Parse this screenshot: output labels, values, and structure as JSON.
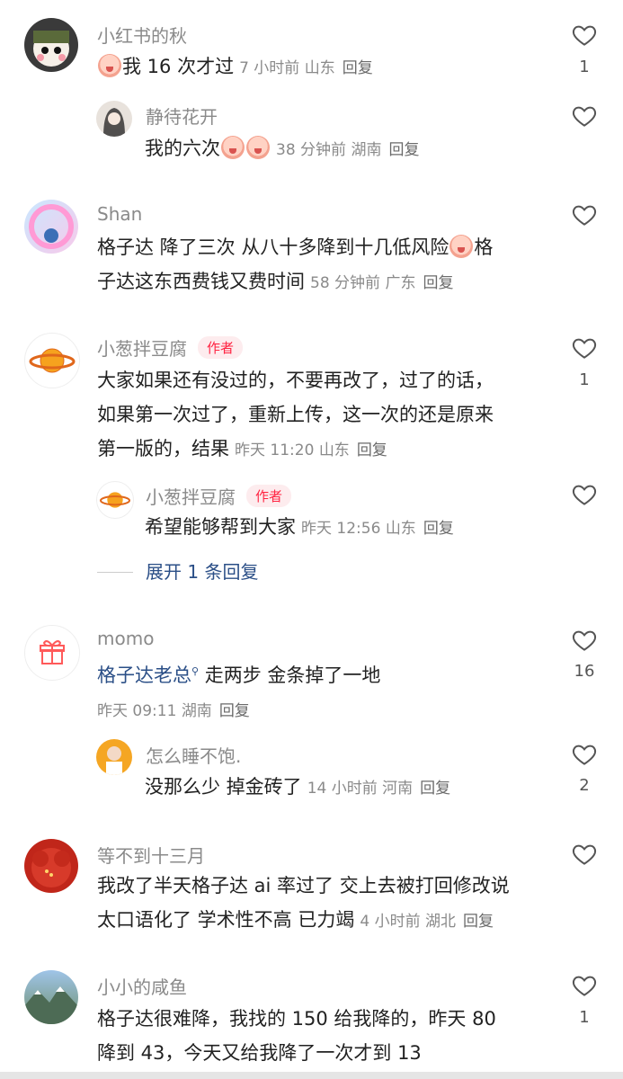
{
  "comments": [
    {
      "name": "小红书的秋",
      "text": "我 16 次才过",
      "time": "7 小时前",
      "location": "山东",
      "reply_label": "回复",
      "likes": "1",
      "replies": [
        {
          "name": "静待花开",
          "text": "我的六次",
          "time": "38 分钟前",
          "location": "湖南",
          "reply_label": "回复"
        }
      ]
    },
    {
      "name": "Shan",
      "text_line1": "格子达 降了三次 从八十多降到十几低风险",
      "text_line1_tail": "格",
      "text_line2": "子达这东西费钱又费时间",
      "time": "58 分钟前",
      "location": "广东",
      "reply_label": "回复"
    },
    {
      "name": "小葱拌豆腐",
      "badge": "作者",
      "text_line1": "大家如果还有没过的，不要再改了，过了的话，",
      "text_line2": "如果第一次过了，重新上传，这一次的还是原来",
      "text_line3": "第一版的，结果",
      "time": "昨天 11:20",
      "location": "山东",
      "reply_label": "回复",
      "likes": "1",
      "replies": [
        {
          "name": "小葱拌豆腐",
          "badge": "作者",
          "text": "希望能够帮到大家",
          "time": "昨天 12:56",
          "location": "山东",
          "reply_label": "回复"
        }
      ],
      "expand_label": "展开 1 条回复"
    },
    {
      "name": "momo",
      "mention": "格子达老总",
      "text": " 走两步 金条掉了一地",
      "time": "昨天 09:11",
      "location": "湖南",
      "reply_label": "回复",
      "likes": "16",
      "replies": [
        {
          "name": "怎么睡不饱.",
          "text": "没那么少 掉金砖了",
          "time": "14 小时前",
          "location": "河南",
          "reply_label": "回复",
          "likes": "2"
        }
      ]
    },
    {
      "name": "等不到十三月",
      "text_line1": "我改了半天格子达 ai 率过了 交上去被打回修改说",
      "text_line2": "太口语化了 学术性不高 已力竭",
      "time": "4 小时前",
      "location": "湖北",
      "reply_label": "回复"
    },
    {
      "name": "小小的咸鱼",
      "text_line1": "格子达很难降，我找的 150 给我降的，昨天 80",
      "text_line2": "降到 43，今天又给我降了一次才到 13",
      "likes": "1"
    }
  ],
  "icons": {
    "like": "heart-outline-icon",
    "emoji": "crying-face-emoji-icon",
    "gift": "gift-icon",
    "planet": "planet-icon"
  },
  "colors": {
    "author_badge": "#ff2442",
    "link": "#2b4f87",
    "meta": "#8a8a8a"
  }
}
